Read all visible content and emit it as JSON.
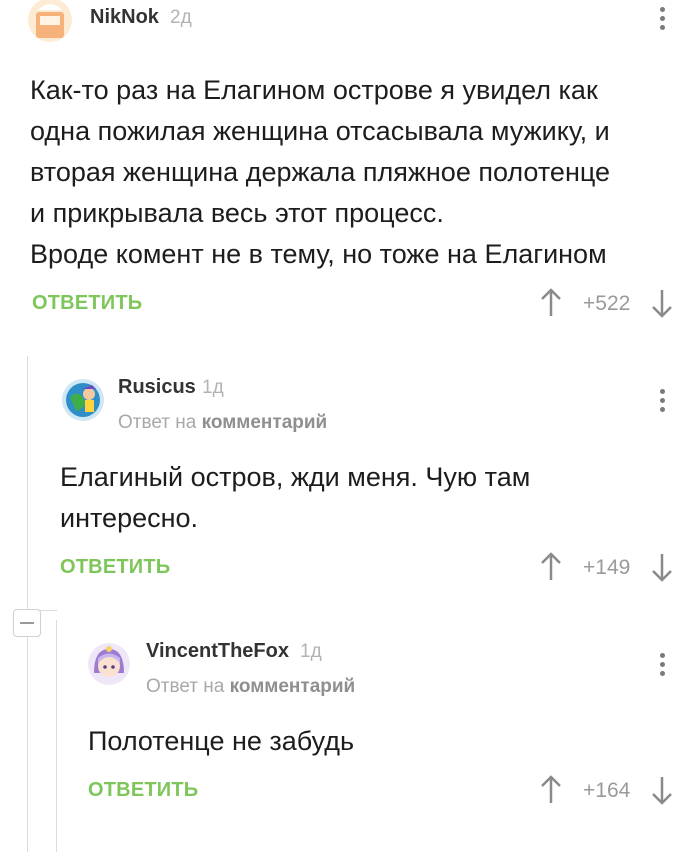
{
  "comments": [
    {
      "user": "NikNok",
      "time": "2д",
      "text_lines": [
        "Как-то раз на Елагином острове я увидел как",
        "одна пожилая женщина отсасывала мужику, и",
        "вторая женщина держала пляжное полотенце",
        "и прикрывала весь этот процесс.",
        "Вроде комент не в тему, но тоже на Елагином"
      ],
      "reply_label": "ОТВЕТИТЬ",
      "rating": "+522"
    },
    {
      "user": "Rusicus",
      "time": "1д",
      "reply_to_prefix": "Ответ на",
      "reply_to_target": "комментарий",
      "text_lines": [
        "Елагиный остров, жди меня. Чую там",
        "интересно."
      ],
      "reply_label": "ОТВЕТИТЬ",
      "rating": "+149"
    },
    {
      "user": "VincentTheFox",
      "time": "1д",
      "reply_to_prefix": "Ответ на",
      "reply_to_target": "комментарий",
      "text_lines": [
        "Полотенце не забудь"
      ],
      "reply_label": "ОТВЕТИТЬ",
      "rating": "+164"
    }
  ],
  "colors": {
    "accent": "#7ec65a",
    "muted": "#9a9a9a",
    "thread_line": "#dcdcdc"
  },
  "icons": [
    "more-vertical-icon",
    "arrow-up-icon",
    "arrow-down-icon",
    "collapse-thread-icon"
  ]
}
